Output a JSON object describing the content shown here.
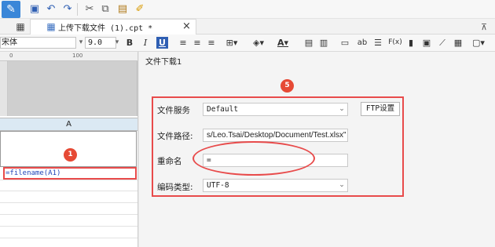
{
  "toolbar": {
    "app_icon": "report-icon",
    "icons": [
      "save-icon",
      "undo-icon",
      "redo-icon",
      "cut-icon",
      "copy-icon",
      "paste-icon",
      "format-painter-icon"
    ],
    "pin_icon": "pin-icon"
  },
  "tabs": [
    {
      "label": "上传下载文件 (1).cpt *",
      "active": true,
      "close": "×"
    }
  ],
  "format_bar": {
    "font": "宋体",
    "size": "9.0",
    "bold": "B",
    "italic": "I",
    "underline": "U",
    "format_label": "ab",
    "formula_label": "F(x)"
  },
  "ruler": {
    "mark0": "0",
    "mark100": "100"
  },
  "sheet": {
    "column_header": "A",
    "cell_value": "=filename(A1)",
    "badge": "1"
  },
  "panel": {
    "title": "文件下载1",
    "badge": "5",
    "fields": {
      "service": {
        "label": "文件服务",
        "value": "Default"
      },
      "ftp_button": "FTP设置",
      "path": {
        "label": "文件路径:",
        "value": "s/Leo.Tsai/Desktop/Document/Test.xlsx\""
      },
      "rename": {
        "label": "重命名",
        "value": "="
      },
      "encoding": {
        "label": "编码类型:",
        "value": "UTF-8"
      }
    }
  },
  "colors": {
    "accent": "#3a86d8",
    "highlight": "#e84b4b",
    "badge": "#e64a35",
    "formula": "#1f44b8"
  }
}
